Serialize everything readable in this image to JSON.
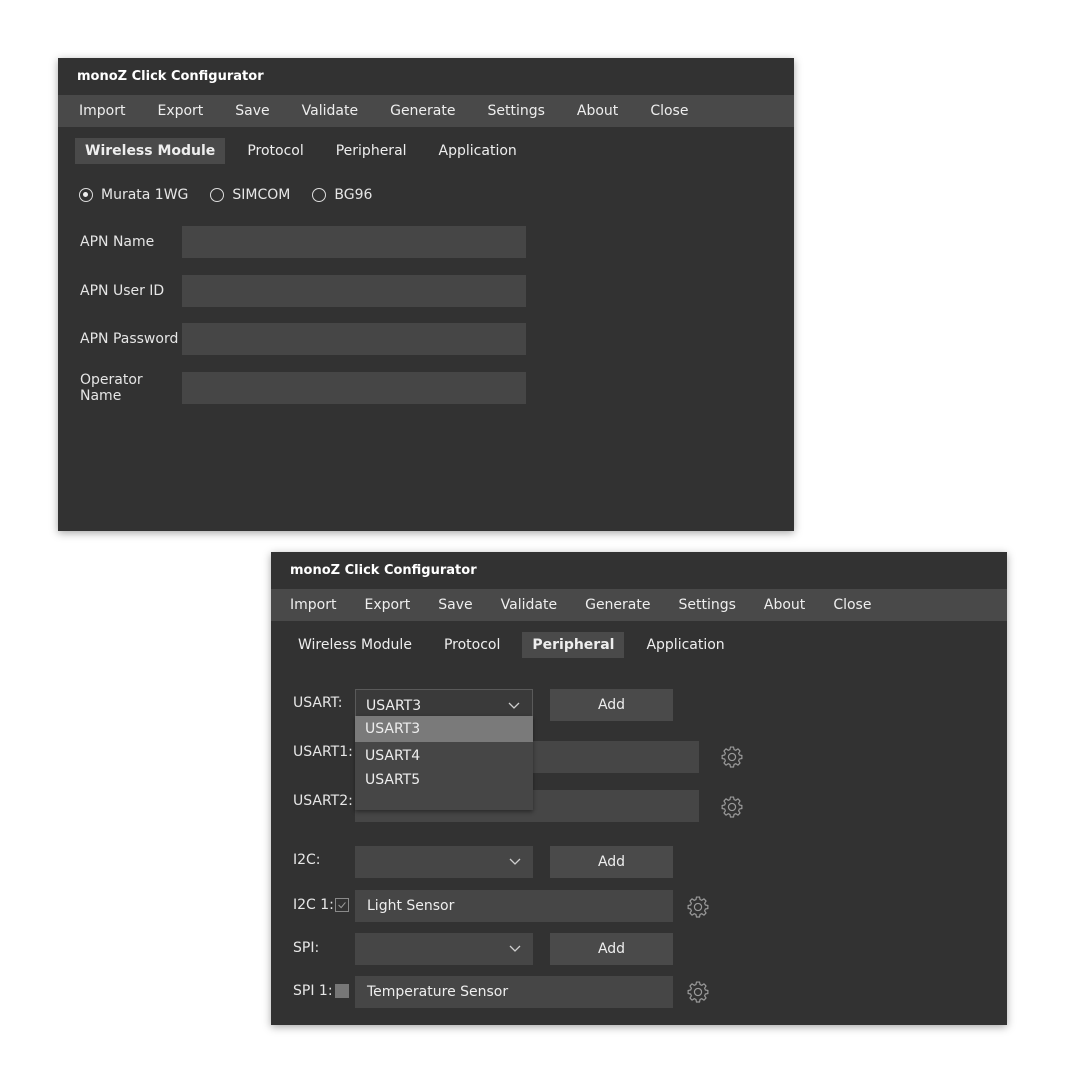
{
  "window1": {
    "title": "monoZ Click Configurator",
    "menu": [
      "Import",
      "Export",
      "Save",
      "Validate",
      "Generate",
      "Settings",
      "About",
      "Close"
    ],
    "tabs": [
      "Wireless Module",
      "Protocol",
      "Peripheral",
      "Application"
    ],
    "active_tab": "Wireless Module",
    "radios": [
      {
        "label": "Murata 1WG",
        "checked": true
      },
      {
        "label": "SIMCOM",
        "checked": false
      },
      {
        "label": "BG96",
        "checked": false
      }
    ],
    "fields": [
      {
        "label": "APN Name",
        "value": ""
      },
      {
        "label": "APN User ID",
        "value": ""
      },
      {
        "label": "APN Password",
        "value": ""
      },
      {
        "label": "Operator Name",
        "value": ""
      }
    ]
  },
  "window2": {
    "title": "monoZ Click Configurator",
    "menu": [
      "Import",
      "Export",
      "Save",
      "Validate",
      "Generate",
      "Settings",
      "About",
      "Close"
    ],
    "tabs": [
      "Wireless Module",
      "Protocol",
      "Peripheral",
      "Application"
    ],
    "active_tab": "Peripheral",
    "usart": {
      "label": "USART:",
      "selected": "USART3",
      "add_label": "Add",
      "options": [
        "USART3",
        "USART4",
        "USART5"
      ],
      "entries": [
        {
          "label": "USART1:",
          "value": ""
        },
        {
          "label": "USART2:",
          "value": ""
        }
      ]
    },
    "i2c": {
      "label": "I2C:",
      "selected": "",
      "add_label": "Add",
      "entry_label": "I2C 1:",
      "entry_checked": true,
      "entry_value": "Light Sensor"
    },
    "spi": {
      "label": "SPI:",
      "selected": "",
      "add_label": "Add",
      "entry_label": "SPI 1:",
      "entry_checked": false,
      "entry_value": "Temperature Sensor"
    }
  },
  "icons": {
    "settings": "gear-icon",
    "dropdown": "chevron-down-icon"
  },
  "colors": {
    "window_bg": "#323232",
    "menubar_bg": "#494949",
    "input_bg": "#464646",
    "dropdown_selected": "#7a7a7a",
    "text": "#e6e6e6"
  }
}
